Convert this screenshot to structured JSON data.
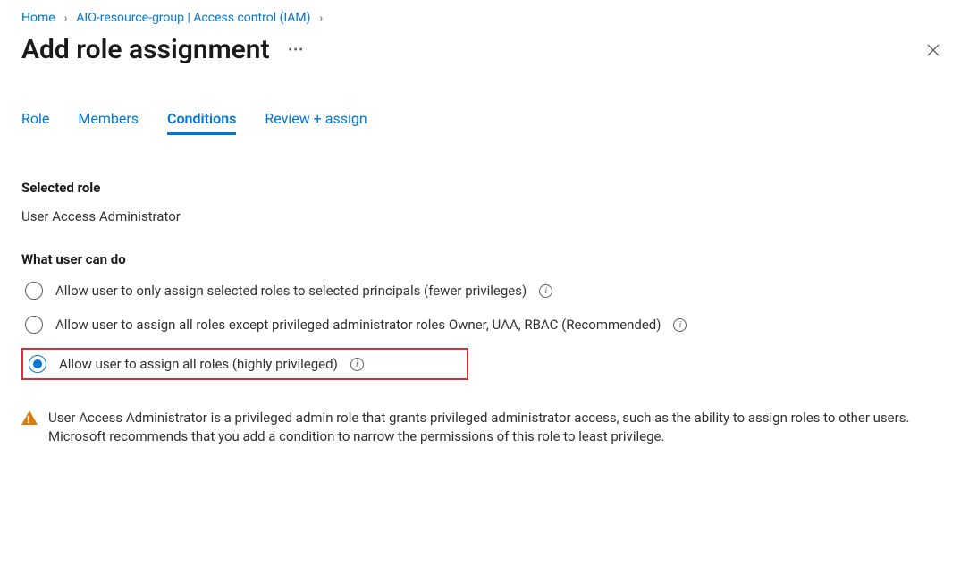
{
  "breadcrumb": {
    "home": "Home",
    "resource": "AIO-resource-group | Access control (IAM)"
  },
  "page": {
    "title": "Add role assignment"
  },
  "tabs": {
    "role": "Role",
    "members": "Members",
    "conditions": "Conditions",
    "review": "Review + assign",
    "active": "conditions"
  },
  "selected_role": {
    "label": "Selected role",
    "value": "User Access Administrator"
  },
  "what_user_can_do": {
    "label": "What user can do",
    "options": [
      "Allow user to only assign selected roles to selected principals (fewer privileges)",
      "Allow user to assign all roles except privileged administrator roles Owner, UAA, RBAC (Recommended)",
      "Allow user to assign all roles (highly privileged)"
    ],
    "selected_index": 2,
    "highlighted_index": 2
  },
  "alert": {
    "text": "User Access Administrator is a privileged admin role that grants privileged administrator access, such as the ability to assign roles to other users. Microsoft recommends that you add a condition to narrow the permissions of this role to least privilege."
  }
}
